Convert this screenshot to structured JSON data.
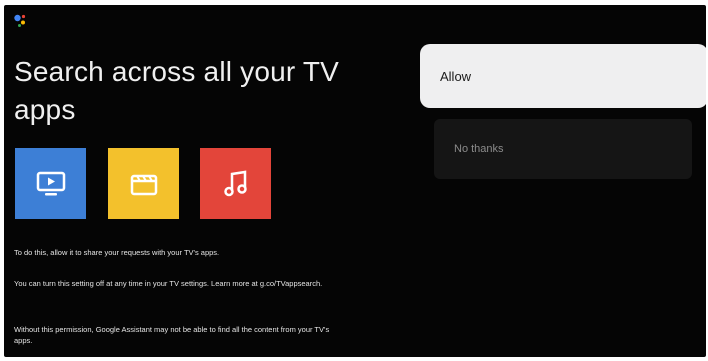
{
  "headline": "Search across all your TV apps",
  "apps": [
    {
      "name": "Video app",
      "icon": "play-screen-icon",
      "color": "#3d7fd6"
    },
    {
      "name": "Movies app",
      "icon": "clapperboard-icon",
      "color": "#f3c12c"
    },
    {
      "name": "Music app",
      "icon": "music-note-icon",
      "color": "#e3453a"
    }
  ],
  "body": {
    "p1": "To do this, allow it to share your requests with your TV's apps.",
    "p2": "You can turn this setting off at any time in your TV settings. Learn more at g.co/TVappsearch.",
    "p3": "Without this permission, Google Assistant may not be able to find all the content from your TV's apps."
  },
  "actions": {
    "allow": "Allow",
    "no_thanks": "No thanks"
  },
  "colors": {
    "background": "#050505",
    "allow_bg": "#efeff0",
    "no_thanks_bg": "#151515"
  }
}
